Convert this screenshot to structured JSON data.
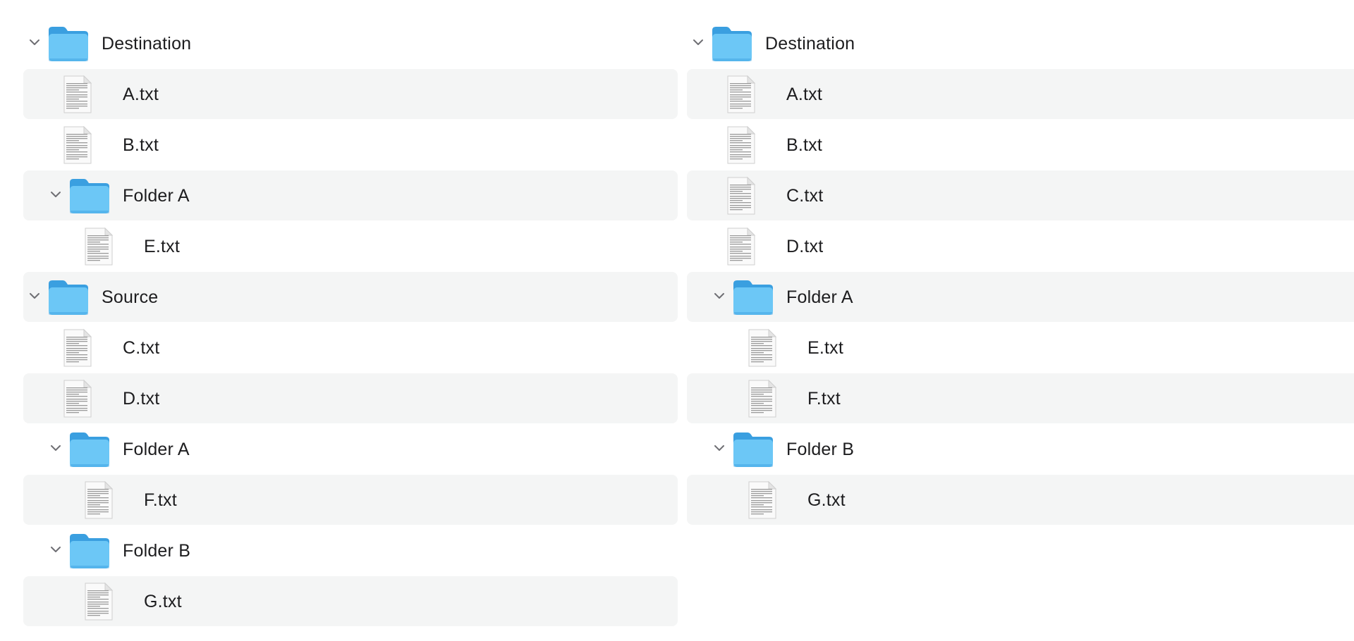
{
  "left_tree": {
    "rows": [
      {
        "type": "folder",
        "depth": 0,
        "name": "Destination",
        "expanded": true,
        "icon": "folder-icon"
      },
      {
        "type": "file",
        "depth": 1,
        "name": "A.txt",
        "icon": "text-document-icon"
      },
      {
        "type": "file",
        "depth": 1,
        "name": "B.txt",
        "icon": "text-document-icon"
      },
      {
        "type": "folder",
        "depth": 1,
        "name": "Folder A",
        "expanded": true,
        "icon": "folder-icon"
      },
      {
        "type": "file",
        "depth": 2,
        "name": "E.txt",
        "icon": "text-document-icon"
      },
      {
        "type": "folder",
        "depth": 0,
        "name": "Source",
        "expanded": true,
        "icon": "folder-icon"
      },
      {
        "type": "file",
        "depth": 1,
        "name": "C.txt",
        "icon": "text-document-icon"
      },
      {
        "type": "file",
        "depth": 1,
        "name": "D.txt",
        "icon": "text-document-icon"
      },
      {
        "type": "folder",
        "depth": 1,
        "name": "Folder A",
        "expanded": true,
        "icon": "folder-icon"
      },
      {
        "type": "file",
        "depth": 2,
        "name": "F.txt",
        "icon": "text-document-icon"
      },
      {
        "type": "folder",
        "depth": 1,
        "name": "Folder B",
        "expanded": true,
        "icon": "folder-icon"
      },
      {
        "type": "file",
        "depth": 2,
        "name": "G.txt",
        "icon": "text-document-icon"
      }
    ]
  },
  "right_tree": {
    "rows": [
      {
        "type": "folder",
        "depth": 0,
        "name": "Destination",
        "expanded": true,
        "icon": "folder-icon"
      },
      {
        "type": "file",
        "depth": 1,
        "name": "A.txt",
        "icon": "text-document-icon"
      },
      {
        "type": "file",
        "depth": 1,
        "name": "B.txt",
        "icon": "text-document-icon"
      },
      {
        "type": "file",
        "depth": 1,
        "name": "C.txt",
        "icon": "text-document-icon"
      },
      {
        "type": "file",
        "depth": 1,
        "name": "D.txt",
        "icon": "text-document-icon"
      },
      {
        "type": "folder",
        "depth": 1,
        "name": "Folder A",
        "expanded": true,
        "icon": "folder-icon"
      },
      {
        "type": "file",
        "depth": 2,
        "name": "E.txt",
        "icon": "text-document-icon"
      },
      {
        "type": "file",
        "depth": 2,
        "name": "F.txt",
        "icon": "text-document-icon"
      },
      {
        "type": "folder",
        "depth": 1,
        "name": "Folder B",
        "expanded": true,
        "icon": "folder-icon"
      },
      {
        "type": "file",
        "depth": 2,
        "name": "G.txt",
        "icon": "text-document-icon"
      }
    ]
  },
  "colors": {
    "stripe": "#f4f5f5",
    "folder_body": "#6cc7f6",
    "folder_tab": "#3a9fe0",
    "text": "#1d1d1f",
    "chevron": "#6e6e73"
  }
}
